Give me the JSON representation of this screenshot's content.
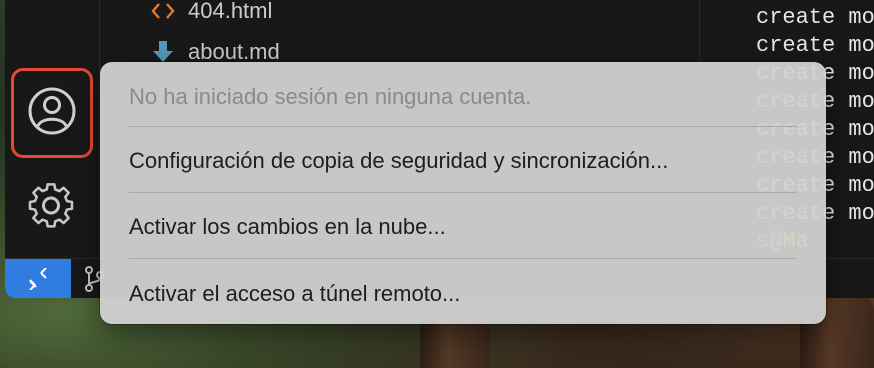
{
  "explorer": {
    "files": [
      {
        "name": "404.html",
        "icon": "html-file-icon"
      },
      {
        "name": "about.md",
        "icon": "markdown-file-icon"
      }
    ]
  },
  "terminal": {
    "lines": [
      "create mo",
      "create mo",
      "create mo",
      "create mo",
      "create mo",
      "create mo",
      "create mo",
      "create mo"
    ],
    "prompt": {
      "user": "s",
      "at": "@",
      "host": "Ma"
    }
  },
  "activity_bar": {
    "icons": [
      "account-icon",
      "gear-icon"
    ]
  },
  "status_bar": {
    "icons": [
      "remote-icon",
      "source-control-branch-icon"
    ]
  },
  "account_menu": {
    "items": [
      {
        "label": "No ha iniciado sesión en ninguna cuenta.",
        "enabled": false
      },
      {
        "label": "Configuración de copia de seguridad y sincronización...",
        "enabled": true
      },
      {
        "label": "Activar los cambios en la nube...",
        "enabled": true
      },
      {
        "label": "Activar el acceso a túnel remoto...",
        "enabled": true
      }
    ]
  },
  "colors": {
    "highlight_border": "#e64a32",
    "remote_button": "#2f7de1",
    "html_icon": "#e37933",
    "markdown_icon": "#519aba"
  }
}
